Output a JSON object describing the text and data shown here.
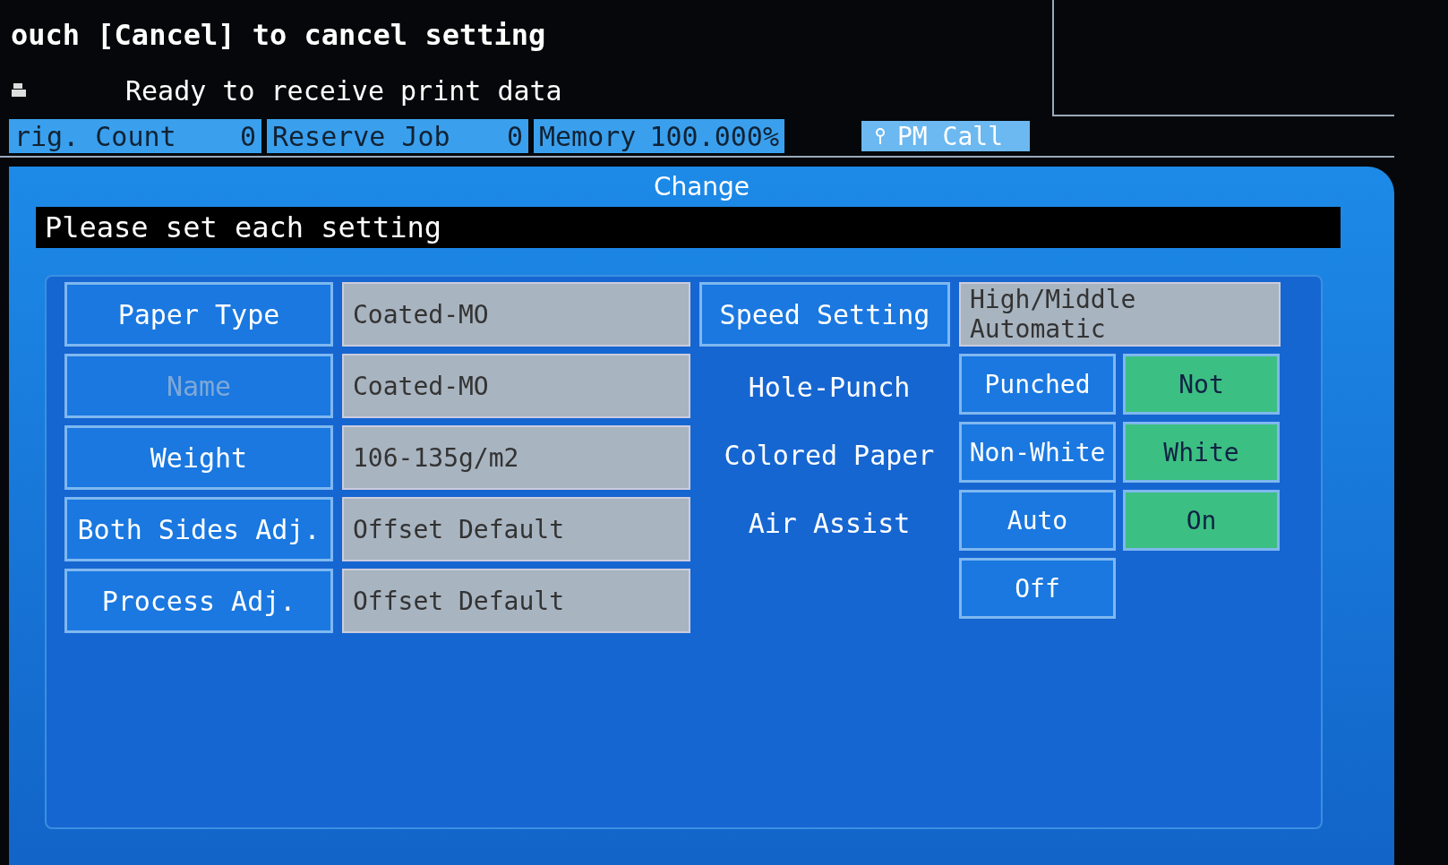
{
  "messages": [
    "ouch [Cancel] to cancel setting",
    "Ready to receive print data"
  ],
  "status_bar": [
    {
      "label": "rig. Count",
      "value": "0"
    },
    {
      "label": "Reserve Job",
      "value": "0"
    },
    {
      "label": "Memory",
      "value": "100.000%"
    }
  ],
  "pm_call": "PM Call",
  "dialog": {
    "title": "Change",
    "instruction": "Please set each setting",
    "settings": [
      {
        "label": "Paper Type",
        "value": "Coated-MO",
        "disabled": false
      },
      {
        "label": "Name",
        "value": "Coated-MO",
        "disabled": true
      },
      {
        "label": "Weight",
        "value": "106-135g/m2",
        "disabled": false
      },
      {
        "label": "Both Sides Adj.",
        "value": "Offset Default",
        "disabled": false
      },
      {
        "label": "Process Adj.",
        "value": "Offset Default",
        "disabled": false
      }
    ],
    "speed": {
      "label": "Speed Setting",
      "value": "High/Middle Automatic"
    },
    "options": [
      {
        "label": "Hole-Punch",
        "choices": [
          {
            "label": "Punched",
            "selected": false
          },
          {
            "label": "Not",
            "selected": true
          }
        ]
      },
      {
        "label": "Colored Paper",
        "choices": [
          {
            "label": "Non-White",
            "selected": false
          },
          {
            "label": "White",
            "selected": true
          }
        ]
      },
      {
        "label": "Air Assist",
        "choices": [
          {
            "label": "Auto",
            "selected": false
          },
          {
            "label": "On",
            "selected": true
          },
          {
            "label": "Off",
            "selected": false
          }
        ]
      }
    ]
  }
}
